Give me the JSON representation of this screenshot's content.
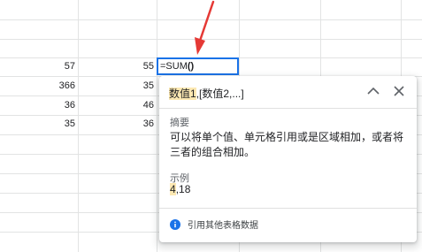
{
  "sheet": {
    "rows": [
      {
        "col_a": "57",
        "col_b": "55"
      },
      {
        "col_a": "366",
        "col_b": "35"
      },
      {
        "col_a": "36",
        "col_b": "46"
      },
      {
        "col_a": "35",
        "col_b": "36"
      }
    ]
  },
  "active_cell": {
    "formula_prefix": "=SUM",
    "formula_parens": "()"
  },
  "popup": {
    "signature_arg1": "数值1",
    "signature_rest": ",[数值2,...]",
    "summary_label": "摘要",
    "summary_text": "可以将单个值、单元格引用或是区域相加，或者将三者的组合相加。",
    "example_label": "示例",
    "example_highlight": "4",
    "example_rest": ",18",
    "link_text": "引用其他表格数据",
    "collapse_icon": "chevron-up-icon",
    "close_icon": "close-icon",
    "info_icon": "info-icon"
  },
  "colors": {
    "accent": "#1a73e8",
    "arrow": "#e53935",
    "highlight": "#fce8b2"
  }
}
